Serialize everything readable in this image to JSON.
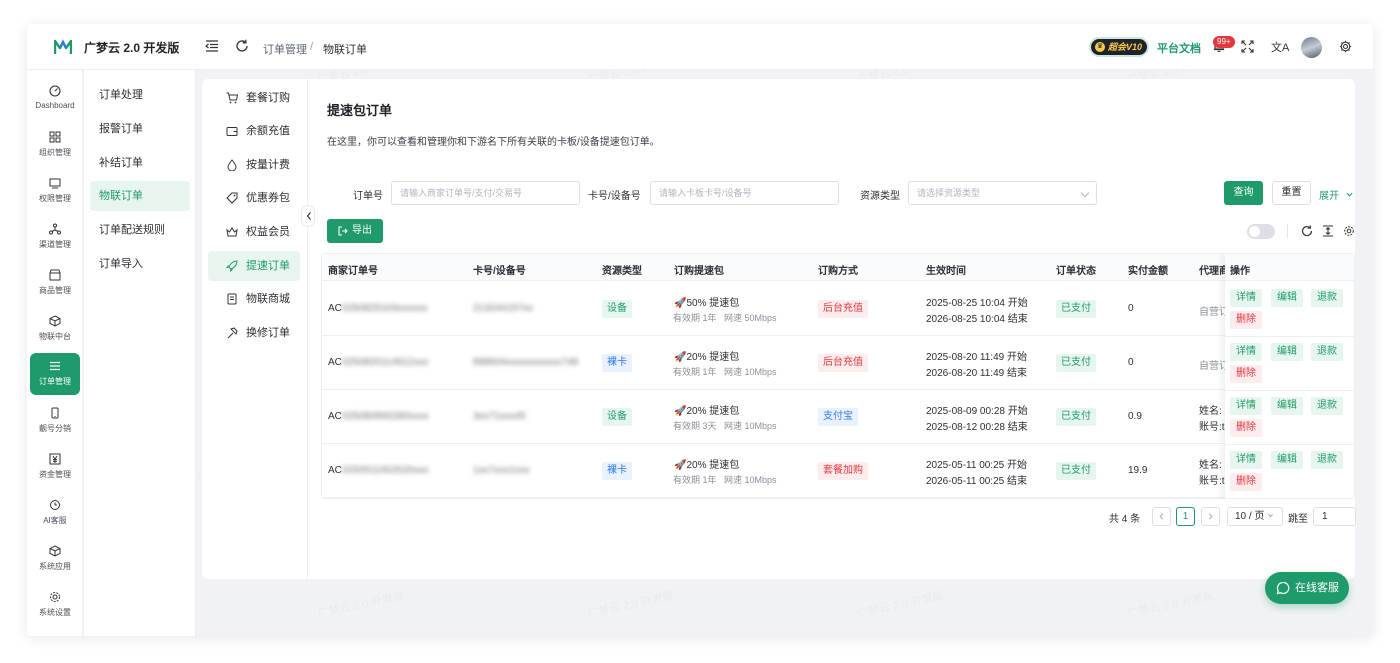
{
  "app": {
    "brand": "广梦云 2.0 开发版"
  },
  "header": {
    "breadcrumb": [
      "订单管理",
      "物联订单"
    ],
    "breadcrumb_sep": "/",
    "vip_label": "超会V10",
    "docs_label": "平台文档",
    "notification_count": "99+",
    "translate_glyph": "文A"
  },
  "rail": {
    "items": [
      {
        "label": "Dashboard",
        "icon": "dashboard-icon"
      },
      {
        "label": "组织管理",
        "icon": "grid-icon"
      },
      {
        "label": "权限管理",
        "icon": "monitor-icon"
      },
      {
        "label": "渠道管理",
        "icon": "network-icon"
      },
      {
        "label": "商品管理",
        "icon": "store-icon"
      },
      {
        "label": "物联中台",
        "icon": "cube-icon"
      },
      {
        "label": "订单管理",
        "icon": "list-icon",
        "active": true
      },
      {
        "label": "靓号分销",
        "icon": "phone-icon"
      },
      {
        "label": "资金管理",
        "icon": "yuan-icon"
      },
      {
        "label": "AI客服",
        "icon": "ai-icon"
      },
      {
        "label": "系统应用",
        "icon": "box-icon"
      },
      {
        "label": "系统设置",
        "icon": "settings-icon"
      }
    ]
  },
  "submenu": {
    "items": [
      "订单处理",
      "报警订单",
      "补结订单",
      "物联订单",
      "订单配送规则",
      "订单导入"
    ],
    "active_index": 3
  },
  "panel": {
    "items": [
      {
        "label": "套餐订购",
        "icon": "cart-icon"
      },
      {
        "label": "余额充值",
        "icon": "wallet-icon"
      },
      {
        "label": "按量计费",
        "icon": "drop-icon"
      },
      {
        "label": "优惠券包",
        "icon": "tag-icon"
      },
      {
        "label": "权益会员",
        "icon": "crown-icon"
      },
      {
        "label": "提速订单",
        "icon": "rocket-icon",
        "active": true
      },
      {
        "label": "物联商城",
        "icon": "book-icon"
      },
      {
        "label": "换修订单",
        "icon": "hammer-icon"
      }
    ]
  },
  "page": {
    "title": "提速包订单",
    "description": "在这里，你可以查看和管理你和下游名下所有关联的卡板/设备提速包订单。"
  },
  "filters": {
    "order_no": {
      "label": "订单号",
      "placeholder": "请输入商家订单号/支付/交易号"
    },
    "card_no": {
      "label": "卡号/设备号",
      "placeholder": "请输入卡板卡号/设备号"
    },
    "resource_type": {
      "label": "资源类型",
      "placeholder": "请选择资源类型"
    },
    "query_label": "查询",
    "reset_label": "重置",
    "expand_label": "展开"
  },
  "toolbar": {
    "export_label": "导出"
  },
  "table": {
    "columns": [
      "商家订单号",
      "卡号/设备号",
      "资源类型",
      "订购提速包",
      "订购方式",
      "生效时间",
      "订单状态",
      "实付金额",
      "代理商",
      "操作"
    ],
    "rows": [
      {
        "order_prefix": "AC",
        "order_rest": "0250825104xxxxxx",
        "card": "213244157xx",
        "resource": "设备",
        "resource_color": "green",
        "package": "50% 提速包",
        "validity": "有效期 1年",
        "speed": "网速 50Mbps",
        "method": "后台充值",
        "method_color": "red",
        "start": "2025-08-25 10:04 开始",
        "end": "2026-08-25 10:04 结束",
        "status": "已支付",
        "amount": "0",
        "agent_1": "自营订单",
        "agent_2": ""
      },
      {
        "order_prefix": "AC",
        "order_rest": "0250820114912xxx",
        "card": "898604xxxxxxxxxxx748",
        "resource": "裸卡",
        "resource_color": "blue",
        "package": "20% 提速包",
        "validity": "有效期 1年",
        "speed": "网速 10Mbps",
        "method": "后台充值",
        "method_color": "red",
        "start": "2025-08-20 11:49 开始",
        "end": "2026-08-20 11:49 结束",
        "status": "已支付",
        "amount": "0",
        "agent_1": "自营订单",
        "agent_2": ""
      },
      {
        "order_prefix": "AC",
        "order_rest": "025080900280xxxx",
        "card": "3xx71xxx45",
        "resource": "设备",
        "resource_color": "green",
        "package": "20% 提速包",
        "validity": "有效期 3天",
        "speed": "网速 10Mbps",
        "method": "支付宝",
        "method_color": "blue",
        "start": "2025-08-09 00:28 开始",
        "end": "2025-08-12 00:28 结束",
        "status": "已支付",
        "amount": "0.9",
        "agent_1": "姓名: 鹏",
        "agent_2": "账号:test"
      },
      {
        "order_prefix": "AC",
        "order_rest": "0250511002520xxx",
        "card": "1xx7xxx1xxx",
        "resource": "裸卡",
        "resource_color": "blue",
        "package": "20% 提速包",
        "validity": "有效期 1年",
        "speed": "网速 10Mbps",
        "method": "套餐加购",
        "method_color": "red",
        "start": "2025-05-11 00:25 开始",
        "end": "2026-05-11 00:25 结束",
        "status": "已支付",
        "amount": "19.9",
        "agent_1": "姓名: 鹏",
        "agent_2": "账号:test"
      }
    ],
    "actions": {
      "detail": "详情",
      "edit": "编辑",
      "refund": "退款",
      "delete": "删除"
    }
  },
  "pagination": {
    "total": "共 4 条",
    "current_page": "1",
    "page_size": "10 / 页",
    "jump_label": "跳至",
    "jump_value": "1"
  },
  "support": {
    "label": "在线客服"
  },
  "watermark": "广梦云 2.0 开发版"
}
